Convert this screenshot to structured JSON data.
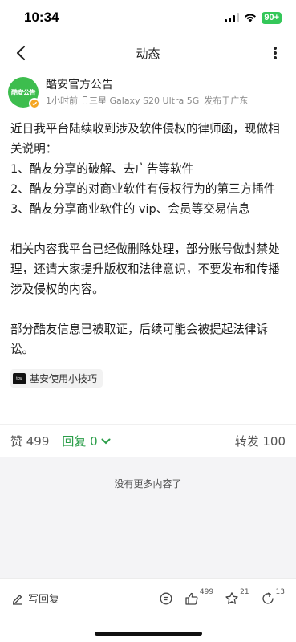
{
  "status_bar": {
    "time": "10:34",
    "battery": "90+"
  },
  "nav": {
    "title": "动态"
  },
  "post": {
    "author": "酷安官方公告",
    "avatar_text": "酷安公告",
    "time_ago": "1小时前",
    "device": "三星 Galaxy S20 Ultra 5G",
    "location": "发布于广东",
    "paragraphs": [
      "近日我平台陆续收到涉及软件侵权的律师函，现做相关说明：",
      "1、酷友分享的破解、去广告等软件",
      "2、酷友分享的对商业软件有侵权行为的第三方插件",
      "3、酷友分享商业软件的 vip、会员等交易信息",
      "",
      "相关内容我平台已经做删除处理，部分账号做封禁处理，还请大家提升版权和法律意识，不要发布和传播涉及侵权的内容。",
      "",
      "部分酷友信息已被取证，后续可能会被提起法律诉讼。"
    ],
    "tag": {
      "logo": "tcw",
      "label": "基安使用小技巧"
    }
  },
  "actions": {
    "likes": "赞 499",
    "replies": "回复 0",
    "reposts": "转发 100"
  },
  "empty_text": "没有更多内容了",
  "bottom_bar": {
    "write_reply": "写回复",
    "like_count": "499",
    "star_count": "21",
    "share_count": "13"
  },
  "colors": {
    "accent": "#2a9d48",
    "avatar_bg": "#3dbd4e",
    "badge": "#f5a623",
    "battery": "#34c759"
  }
}
